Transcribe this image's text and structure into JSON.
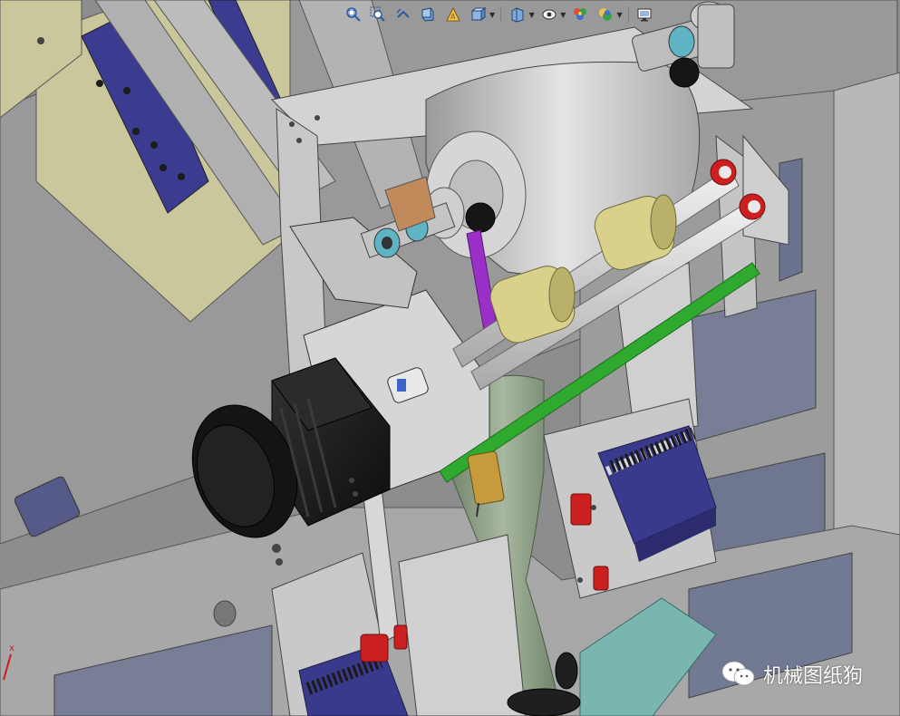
{
  "toolbar": {
    "items": [
      {
        "name": "zoom-to-fit-icon"
      },
      {
        "name": "zoom-to-area-icon"
      },
      {
        "name": "previous-view-icon"
      },
      {
        "name": "section-view-icon"
      },
      {
        "name": "dynamic-annotation-icon"
      },
      {
        "name": "view-orientation-icon"
      },
      {
        "name": "display-style-icon"
      },
      {
        "name": "hide-show-items-icon"
      },
      {
        "name": "edit-appearance-icon"
      },
      {
        "name": "apply-scene-icon"
      },
      {
        "name": "view-settings-icon"
      }
    ]
  },
  "watermark": {
    "text": "机械图纸狗",
    "icon": "wechat-icon"
  },
  "colors": {
    "background": "#8f8f8f",
    "frame": "#c8c8c8",
    "motor": "#1a1a1a",
    "guide_rod": "#2faa2f",
    "belt": "#9b30c8",
    "roller": "#d9d08a",
    "cylinder_body": "#3a3a8c",
    "spring": "#2a2a2a",
    "accent_red": "#cc1f1f",
    "base_plate": "#c8c79a",
    "teal_plate": "#7ab6b0",
    "hopper": "#7f9478"
  }
}
